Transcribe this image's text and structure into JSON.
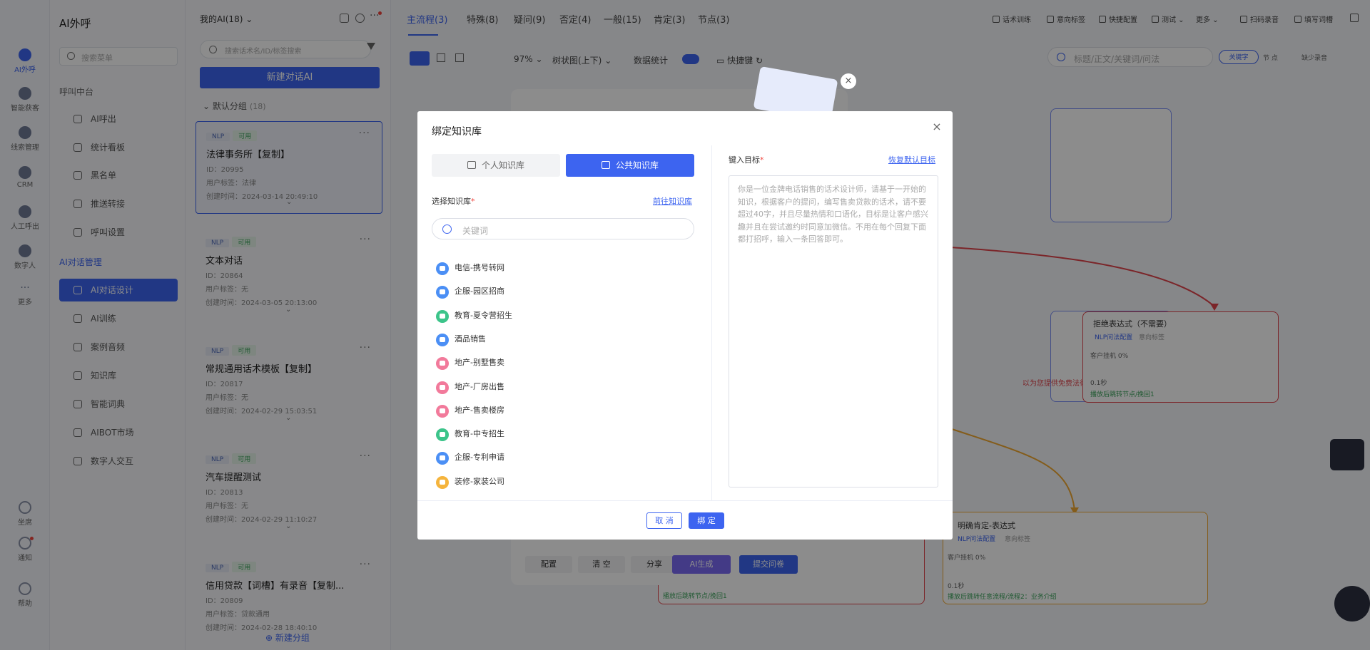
{
  "rail": {
    "items": [
      {
        "label": "AI外呼"
      },
      {
        "label": "智能获客"
      },
      {
        "label": "线索管理"
      },
      {
        "label": "CRM"
      },
      {
        "label": "人工呼出"
      },
      {
        "label": "数字人"
      },
      {
        "label": "更多"
      }
    ],
    "bottom": [
      {
        "label": "坐席"
      },
      {
        "label": "通知"
      },
      {
        "label": "帮助"
      }
    ]
  },
  "menu": {
    "title": "AI外呼",
    "search_placeholder": "搜索菜单",
    "section1": "呼叫中台",
    "items1": [
      {
        "label": "AI呼出"
      },
      {
        "label": "统计看板"
      },
      {
        "label": "黑名单"
      },
      {
        "label": "推送转接"
      },
      {
        "label": "呼叫设置"
      }
    ],
    "section2": "AI对话管理",
    "items2": [
      {
        "label": "AI对话设计"
      },
      {
        "label": "AI训练"
      },
      {
        "label": "案例音频"
      },
      {
        "label": "知识库"
      },
      {
        "label": "智能词典"
      },
      {
        "label": "AIBOT市场"
      },
      {
        "label": "数字人交互"
      }
    ]
  },
  "list": {
    "mine": "我的AI(18)",
    "search_placeholder": "搜索话术名/ID/标签搜索",
    "new_button": "新建对话AI",
    "group": "默认分组",
    "group_count": "(18)",
    "tag_nlp": "NLP",
    "tag_ok": "可用",
    "cards": [
      {
        "title": "法律事务所【复制】",
        "id": "ID：20995",
        "tag": "用户标签：法律",
        "time": "创建时间：2024-03-14 20:49:10"
      },
      {
        "title": "文本对话",
        "id": "ID：20864",
        "tag": "用户标签：无",
        "time": "创建时间：2024-03-05 20:13:00"
      },
      {
        "title": "常规通用话术模板【复制】",
        "id": "ID：20817",
        "tag": "用户标签：无",
        "time": "创建时间：2024-02-29 15:03:51"
      },
      {
        "title": "汽车提醒测试",
        "id": "ID：20813",
        "tag": "用户标签：无",
        "time": "创建时间：2024-02-29 11:10:27"
      },
      {
        "title": "信用贷款【词槽】有录音【复制...",
        "id": "ID：20809",
        "tag": "用户标签：贷款通用",
        "time": "创建时间：2024-02-28 18:40:10"
      }
    ],
    "new_group": "新建分组"
  },
  "main": {
    "tabs": [
      "主流程(3)",
      "特殊(8)",
      "疑问(9)",
      "否定(4)",
      "一般(15)",
      "肯定(3)",
      "节点(3)"
    ],
    "toolbar": [
      "话术训练",
      "意向标签",
      "快捷配置",
      "测试",
      "更多",
      "扫码录音",
      "填写词槽"
    ],
    "zoom": "97%",
    "layout": "树状图(上下)",
    "stats_label": "数据统计",
    "quick_build": "快捷键",
    "search_placeholder": "标题/正文/关键词/问法",
    "search_btns": [
      "关键字",
      "节 点",
      "缺少录音"
    ],
    "panel_btns": [
      "配置",
      "清 空",
      "分享",
      "AI生成",
      "提交问卷"
    ],
    "node_right": {
      "title": "拒绝表达式（不需要）",
      "line1": "NLP问法配置",
      "line2": "意向标签",
      "line3": "客户挂机 0%",
      "line4": "0.1秒",
      "line5": "播放后跳转节点/挽回1"
    },
    "node_bottom": {
      "title": "明确肯定-表达式",
      "line1": "NLP问法配置",
      "line2": "意向标签",
      "line3": "客户挂机 0%",
      "line4": "0.1秒",
      "line5": "播放后跳转任意流程/流程2：业务介绍"
    },
    "node_left_text": "播放后跳转节点/挽回1",
    "node_mid_text": "以为您提供免费法律咨询，企业风"
  },
  "modal": {
    "title": "绑定知识库",
    "tab_private": "个人知识库",
    "tab_public": "公共知识库",
    "select_label": "选择知识库",
    "goto_link": "前往知识库",
    "search_placeholder": "关键词",
    "kb_items": [
      {
        "label": "电信-携号转网",
        "color": "#4b8ff5"
      },
      {
        "label": "企服-园区招商",
        "color": "#4b8ff5"
      },
      {
        "label": "教育-夏令营招生",
        "color": "#3cc48a"
      },
      {
        "label": "酒品销售",
        "color": "#4b8ff5"
      },
      {
        "label": "地产-别墅售卖",
        "color": "#f27a9b"
      },
      {
        "label": "地产-厂房出售",
        "color": "#f27a9b"
      },
      {
        "label": "地产-售卖楼房",
        "color": "#f27a9b"
      },
      {
        "label": "教育-中专招生",
        "color": "#3cc48a"
      },
      {
        "label": "企服-专利申请",
        "color": "#4b8ff5"
      },
      {
        "label": "装修-家装公司",
        "color": "#f5b43c"
      }
    ],
    "target_label": "键入目标",
    "restore_link": "恢复默认目标",
    "target_text": "你是一位金牌电话销售的话术设计师，请基于一开始的知识，根据客户的提问，编写售卖贷款的话术，请不要超过40字，并且尽量热情和口语化，目标是让客户感兴趣并且在尝试邀约时同意加微信。不用在每个回复下面都打招呼，输入一条回答即可。",
    "cancel": "取 消",
    "bind": "绑 定"
  }
}
